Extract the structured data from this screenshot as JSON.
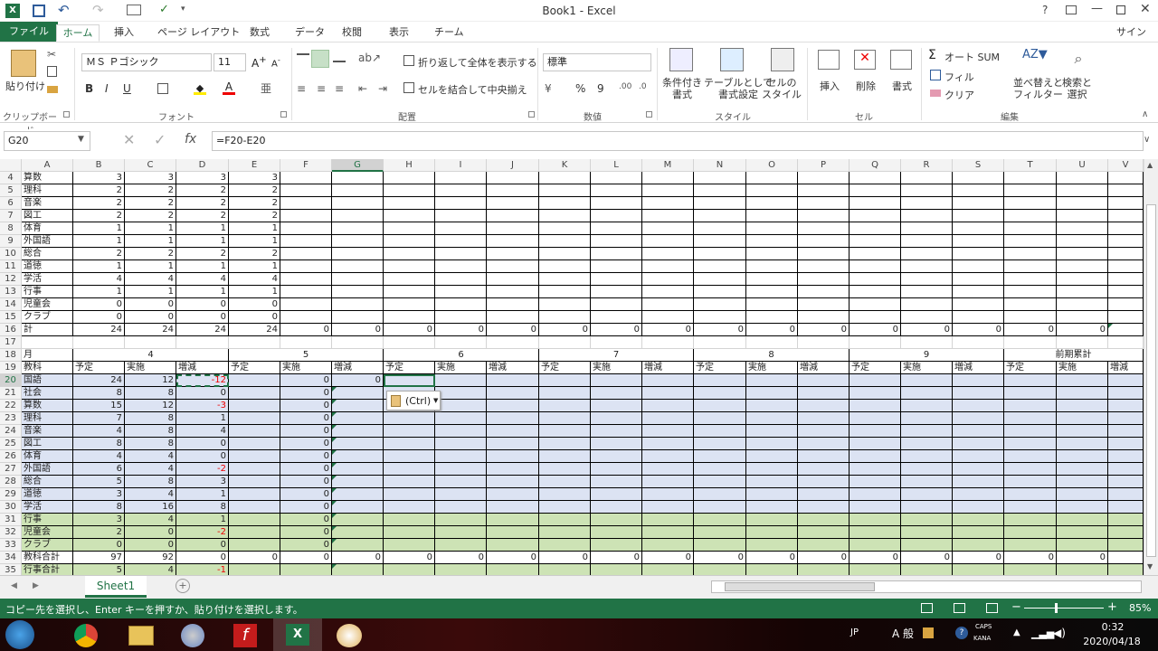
{
  "app": {
    "title": "Book1 - Excel",
    "signin": "サインイン",
    "help": "?"
  },
  "tabs": [
    "ファイル",
    "ホーム",
    "挿入",
    "ページ レイアウト",
    "数式",
    "データ",
    "校閲",
    "表示",
    "チーム"
  ],
  "ribbon": {
    "paste": "貼り付け",
    "clipboard": "クリップボード",
    "font_name": "ＭＳ Ｐゴシック",
    "font_size": "11",
    "font_group": "フォント",
    "bold": "B",
    "italic": "I",
    "underline": "U",
    "wrap": "折り返して全体を表示する",
    "merge": "セルを結合して中央揃え",
    "align_group": "配置",
    "number_format": "標準",
    "percent": "%",
    "comma": "9",
    "number_group": "数値",
    "cond": "条件付き\n書式",
    "table": "テーブルとして\n書式設定",
    "cellstyle": "セルの\nスタイル",
    "style_group": "スタイル",
    "insert": "挿入",
    "delete": "削除",
    "format": "書式",
    "cell_group": "セル",
    "autosum": "オート SUM",
    "fill": "フィル",
    "clear": "クリア",
    "sort": "並べ替えと\nフィルター",
    "find": "検索と\n選択",
    "edit_group": "編集"
  },
  "formula": {
    "namebox": "G20",
    "fx": "fx",
    "value": "=F20-E20"
  },
  "columns": [
    "A",
    "B",
    "C",
    "D",
    "E",
    "F",
    "G",
    "H",
    "I",
    "J",
    "K",
    "L",
    "M",
    "N",
    "O",
    "P",
    "Q",
    "R",
    "S",
    "T",
    "U",
    "V"
  ],
  "top_table": {
    "rows": [
      {
        "n": "4",
        "label": "算数",
        "v": [
          "3",
          "3",
          "3",
          "3"
        ]
      },
      {
        "n": "5",
        "label": "理科",
        "v": [
          "2",
          "2",
          "2",
          "2"
        ]
      },
      {
        "n": "6",
        "label": "音楽",
        "v": [
          "2",
          "2",
          "2",
          "2"
        ]
      },
      {
        "n": "7",
        "label": "図工",
        "v": [
          "2",
          "2",
          "2",
          "2"
        ]
      },
      {
        "n": "8",
        "label": "体育",
        "v": [
          "1",
          "1",
          "1",
          "1"
        ]
      },
      {
        "n": "9",
        "label": "外国語",
        "v": [
          "1",
          "1",
          "1",
          "1"
        ]
      },
      {
        "n": "10",
        "label": "総合",
        "v": [
          "2",
          "2",
          "2",
          "2"
        ]
      },
      {
        "n": "11",
        "label": "道徳",
        "v": [
          "1",
          "1",
          "1",
          "1"
        ]
      },
      {
        "n": "12",
        "label": "学活",
        "v": [
          "4",
          "4",
          "4",
          "4"
        ]
      },
      {
        "n": "13",
        "label": "行事",
        "v": [
          "1",
          "1",
          "1",
          "1"
        ]
      },
      {
        "n": "14",
        "label": "児童会",
        "v": [
          "0",
          "0",
          "0",
          "0"
        ]
      },
      {
        "n": "15",
        "label": "クラブ",
        "v": [
          "0",
          "0",
          "0",
          "0"
        ]
      }
    ],
    "total": {
      "n": "16",
      "label": "計",
      "v": [
        "24",
        "24",
        "24",
        "24",
        "0",
        "0",
        "0",
        "0",
        "0",
        "0",
        "0",
        "0",
        "0",
        "0",
        "0",
        "0",
        "0",
        "0",
        "0",
        "0"
      ]
    }
  },
  "month_row": {
    "n": "18",
    "label": "月",
    "months": [
      "4",
      "5",
      "6",
      "7",
      "8",
      "9",
      "前期累計"
    ]
  },
  "sub_row": {
    "n": "19",
    "label": "教科",
    "subs": [
      "予定",
      "実施",
      "増減"
    ]
  },
  "bottom_table": {
    "rows": [
      {
        "n": "20",
        "label": "国語",
        "v": [
          "24",
          "12",
          "-12",
          "",
          "0",
          "0"
        ],
        "band": "blue"
      },
      {
        "n": "21",
        "label": "社会",
        "v": [
          "8",
          "8",
          "0",
          "",
          "0",
          ""
        ],
        "band": "blue"
      },
      {
        "n": "22",
        "label": "算数",
        "v": [
          "15",
          "12",
          "-3",
          "",
          "0",
          ""
        ],
        "band": "blue"
      },
      {
        "n": "23",
        "label": "理科",
        "v": [
          "7",
          "8",
          "1",
          "",
          "0",
          ""
        ],
        "band": "blue"
      },
      {
        "n": "24",
        "label": "音楽",
        "v": [
          "4",
          "8",
          "4",
          "",
          "0",
          ""
        ],
        "band": "blue"
      },
      {
        "n": "25",
        "label": "図工",
        "v": [
          "8",
          "8",
          "0",
          "",
          "0",
          ""
        ],
        "band": "blue"
      },
      {
        "n": "26",
        "label": "体育",
        "v": [
          "4",
          "4",
          "0",
          "",
          "0",
          ""
        ],
        "band": "blue"
      },
      {
        "n": "27",
        "label": "外国語",
        "v": [
          "6",
          "4",
          "-2",
          "",
          "0",
          ""
        ],
        "band": "blue"
      },
      {
        "n": "28",
        "label": "総合",
        "v": [
          "5",
          "8",
          "3",
          "",
          "0",
          ""
        ],
        "band": "blue"
      },
      {
        "n": "29",
        "label": "道徳",
        "v": [
          "3",
          "4",
          "1",
          "",
          "0",
          ""
        ],
        "band": "blue"
      },
      {
        "n": "30",
        "label": "学活",
        "v": [
          "8",
          "16",
          "8",
          "",
          "0",
          ""
        ],
        "band": "blue"
      },
      {
        "n": "31",
        "label": "行事",
        "v": [
          "3",
          "4",
          "1",
          "",
          "0",
          ""
        ],
        "band": "green"
      },
      {
        "n": "32",
        "label": "児童会",
        "v": [
          "2",
          "0",
          "-2",
          "",
          "0",
          ""
        ],
        "band": "green"
      },
      {
        "n": "33",
        "label": "クラブ",
        "v": [
          "0",
          "0",
          "0",
          "",
          "0",
          ""
        ],
        "band": "green"
      },
      {
        "n": "34",
        "label": "教科合計",
        "v": [
          "97",
          "92",
          "0",
          "0",
          "0",
          "0",
          "0",
          "0",
          "0",
          "0",
          "0",
          "0",
          "0",
          "0",
          "0",
          "0",
          "0",
          "0",
          "0",
          "0"
        ],
        "band": "white"
      },
      {
        "n": "35",
        "label": "行事合計",
        "v": [
          "5",
          "4",
          "-1",
          "",
          "",
          ""
        ],
        "band": "green"
      }
    ]
  },
  "paste_options": "(Ctrl)",
  "sheet": {
    "tab": "Sheet1",
    "add": "+"
  },
  "status": {
    "message": "コピー先を選択し、Enter キーを押すか、貼り付けを選択します。",
    "zoom": "85%"
  },
  "taskbar": {
    "ime": "A 般",
    "lang": "JP",
    "caps": "CAPS",
    "kana": "KANA",
    "time": "0:32",
    "date": "2020/04/18"
  },
  "colors": {
    "excel_green": "#217346",
    "band_blue": "#dce3f3",
    "band_green": "#cde3b5"
  }
}
